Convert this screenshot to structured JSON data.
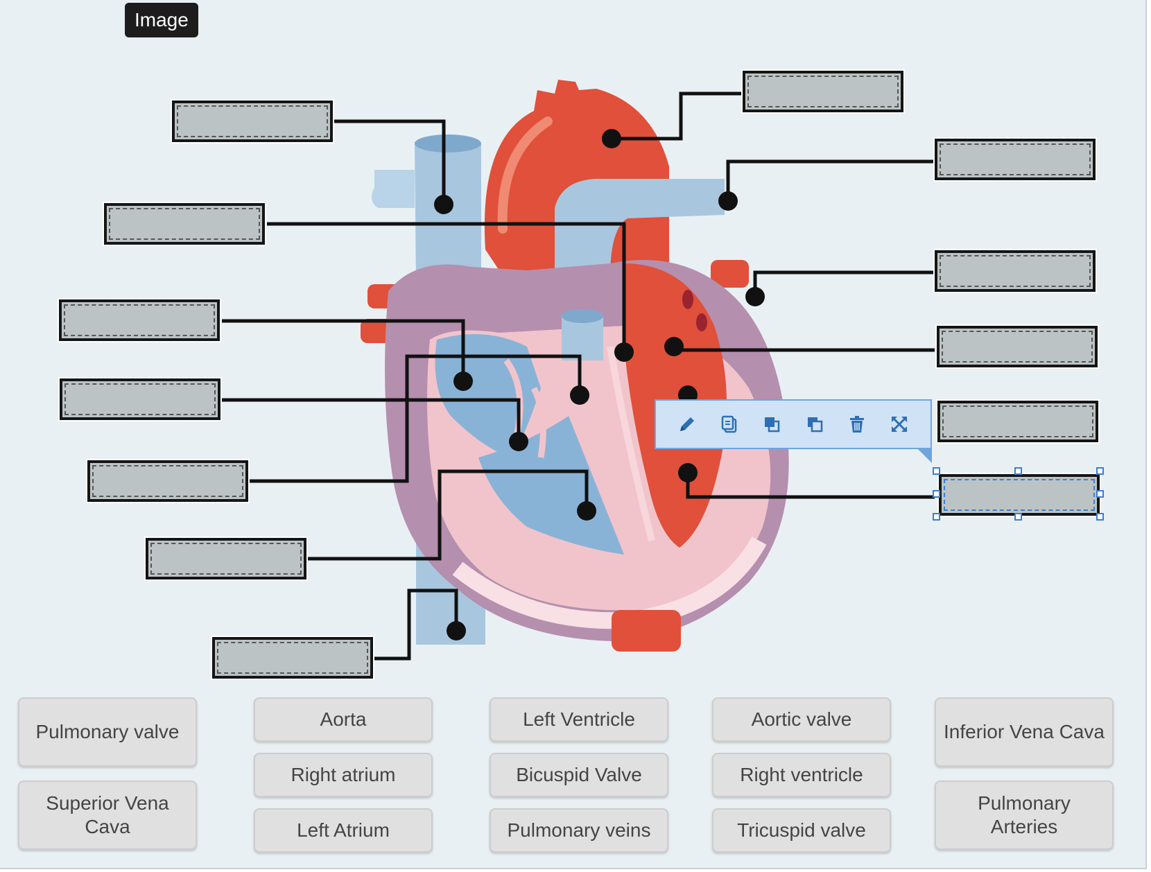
{
  "image_tag": "Image",
  "toolbar": {
    "icons": [
      "pencil-icon",
      "duplicate-icon",
      "bring-front-icon",
      "send-back-icon",
      "trash-icon",
      "expand-icon"
    ]
  },
  "label_bank": {
    "chips": [
      {
        "label": "Pulmonary valve"
      },
      {
        "label": "Superior Vena Cava"
      },
      {
        "label": "Aorta"
      },
      {
        "label": "Right atrium"
      },
      {
        "label": "Left Atrium"
      },
      {
        "label": "Left Ventricle"
      },
      {
        "label": "Bicuspid Valve"
      },
      {
        "label": "Pulmonary veins"
      },
      {
        "label": "Aortic valve"
      },
      {
        "label": "Right ventricle"
      },
      {
        "label": "Tricuspid valve"
      },
      {
        "label": "Inferior Vena Cava"
      },
      {
        "label": "Pulmonary Arteries"
      }
    ]
  },
  "colors": {
    "background": "#e9f0f4",
    "drop_zone": "#bcc3c5",
    "selection": "#3a7fd0",
    "vessel_blue": "#a9c6df",
    "heart_red": "#e0503a",
    "heart_pink": "#e8b4be",
    "heart_purple": "#b58fae"
  }
}
